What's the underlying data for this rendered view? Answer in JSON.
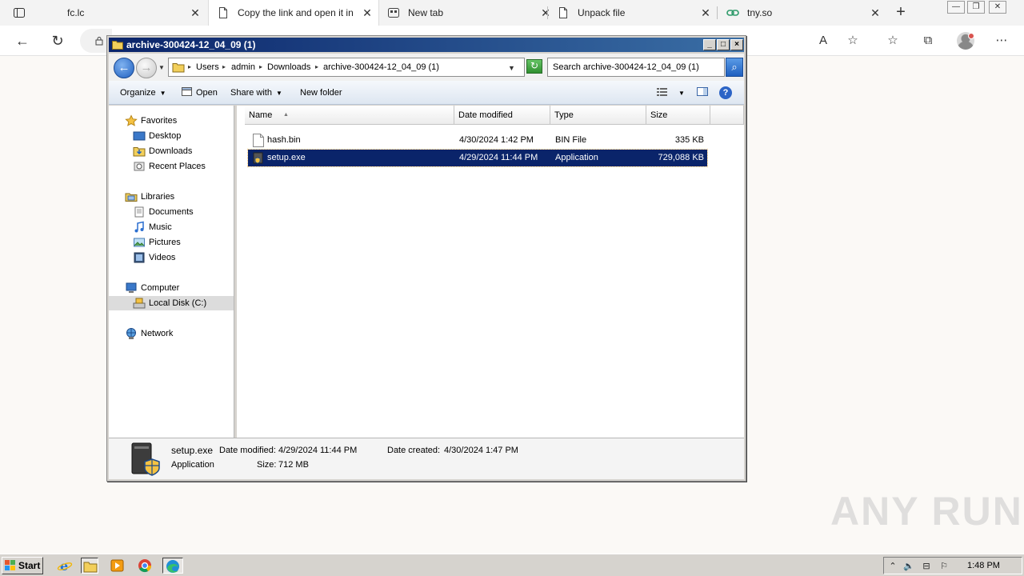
{
  "browser": {
    "tabs": [
      {
        "title": "fc.lc",
        "icon": "page-icon"
      },
      {
        "title": "Copy the link and open it in",
        "icon": "page-icon",
        "active": true
      },
      {
        "title": "New tab",
        "icon": "new-tab-icon"
      },
      {
        "title": "Unpack file",
        "icon": "page-icon"
      },
      {
        "title": "tny.so",
        "icon": "link-icon"
      }
    ],
    "tab_close_glyph": "✕",
    "new_tab_glyph": "+",
    "window_controls": [
      "—",
      "❐",
      "✕"
    ],
    "nav": {
      "back": "←",
      "refresh": "↻"
    },
    "toolbar_icons": [
      "read-aloud-icon",
      "add-favorite-icon",
      "favorites-icon",
      "collections-icon",
      "profile-icon",
      "more-icon"
    ],
    "toolbar_glyphs": {
      "read_aloud": "A",
      "add_favorite": "☆",
      "favorites": "☆",
      "collections": "⧉",
      "more": "⋯"
    }
  },
  "explorer": {
    "title": "archive-300424-12_04_09 (1)",
    "title_buttons": [
      "_",
      "□",
      "×"
    ],
    "breadcrumb": [
      "Users",
      "admin",
      "Downloads",
      "archive-300424-12_04_09 (1)"
    ],
    "search_placeholder": "Search archive-300424-12_04_09 (1)",
    "commands": {
      "organize": "Organize",
      "open": "Open",
      "share_with": "Share with",
      "new_folder": "New folder"
    },
    "nav_pane": {
      "favorites": {
        "label": "Favorites",
        "items": [
          "Desktop",
          "Downloads",
          "Recent Places"
        ]
      },
      "libraries": {
        "label": "Libraries",
        "items": [
          "Documents",
          "Music",
          "Pictures",
          "Videos"
        ]
      },
      "computer": {
        "label": "Computer",
        "items": [
          "Local Disk (C:)"
        ]
      },
      "network": {
        "label": "Network"
      }
    },
    "columns": [
      "Name",
      "Date modified",
      "Type",
      "Size"
    ],
    "files": [
      {
        "name": "hash.bin",
        "modified": "4/30/2024 1:42 PM",
        "type": "BIN File",
        "size": "335 KB",
        "selected": false
      },
      {
        "name": "setup.exe",
        "modified": "4/29/2024 11:44 PM",
        "type": "Application",
        "size": "729,088 KB",
        "selected": true
      }
    ],
    "details": {
      "name": "setup.exe",
      "modified_label": "Date modified:",
      "modified": "4/29/2024 11:44 PM",
      "created_label": "Date created:",
      "created": "4/30/2024 1:47 PM",
      "type": "Application",
      "size_label": "Size:",
      "size": "712 MB"
    }
  },
  "taskbar": {
    "start": "Start",
    "apps": [
      "ie-icon",
      "explorer-icon",
      "media-player-icon",
      "chrome-icon",
      "edge-icon"
    ],
    "clock": "1:48 PM"
  },
  "watermark": "ANY RUN",
  "colors": {
    "title_bar": "#0a246a",
    "selection": "#0a246a",
    "taskbar": "#d6d3ce"
  }
}
